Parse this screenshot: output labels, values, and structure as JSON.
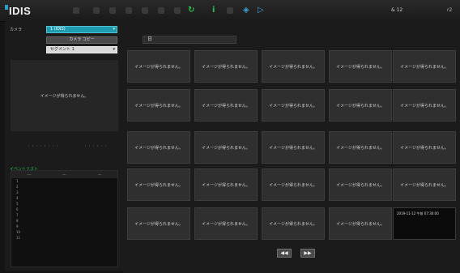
{
  "app": {
    "logo": "IDIS",
    "user": "& 12",
    "close_label": "r2"
  },
  "left": {
    "camera_label": "カメラ",
    "camera_select": "1 (IDIS)",
    "button_label": "カメラ コピー",
    "segment_select": "セグメント 1",
    "preview_text": "イメージが得られません。",
    "link_left": "・・・・・・・・",
    "link_right": "・・・・・・",
    "list_title": "イベントリスト",
    "list_arrows": "∧ ∨",
    "list_headers": [
      "---",
      "---",
      "---"
    ],
    "list_rows": [
      "1",
      "2",
      "3",
      "4",
      "5",
      "6",
      "7",
      "8",
      "9",
      "10",
      "11"
    ]
  },
  "main": {
    "date_value": "日",
    "cell_text": "イメージが得られません。",
    "last_cell_timestamp": "2019-11-12 午前 07:30:00",
    "prev_label": "◀◀",
    "next_label": "▶▶"
  },
  "colors": {
    "accent": "#1f9bb0",
    "green": "#2fbf4e",
    "blue": "#3fa0d8"
  }
}
